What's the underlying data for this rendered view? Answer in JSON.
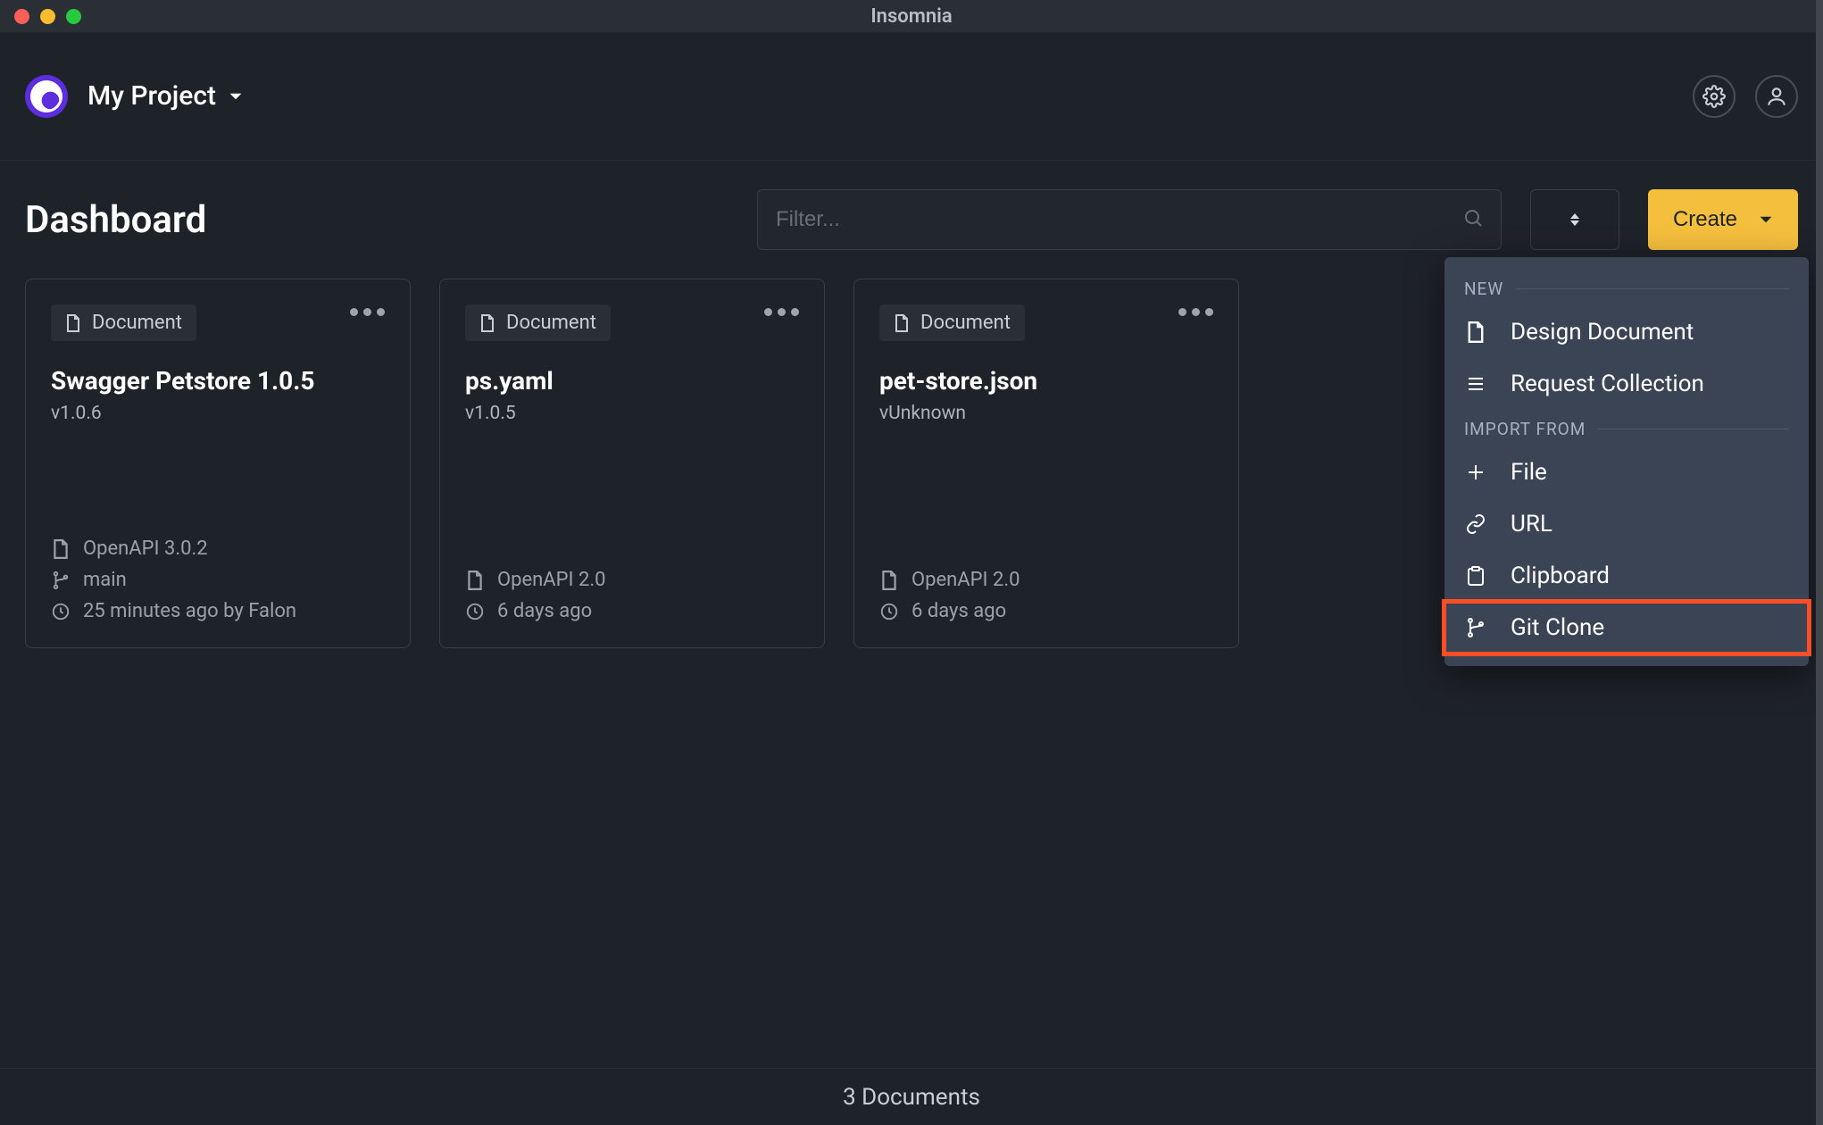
{
  "app": {
    "title": "Insomnia"
  },
  "header": {
    "project_name": "My Project"
  },
  "toolbar": {
    "page_title": "Dashboard",
    "filter_placeholder": "Filter...",
    "create_label": "Create"
  },
  "cards": [
    {
      "tag": "Document",
      "title": "Swagger Petstore 1.0.5",
      "version": "v1.0.6",
      "spec": "OpenAPI 3.0.2",
      "branch": "main",
      "time": "25 minutes ago by Falon"
    },
    {
      "tag": "Document",
      "title": "ps.yaml",
      "version": "v1.0.5",
      "spec": "OpenAPI 2.0",
      "branch": "",
      "time": "6 days ago"
    },
    {
      "tag": "Document",
      "title": "pet-store.json",
      "version": "vUnknown",
      "spec": "OpenAPI 2.0",
      "branch": "",
      "time": "6 days ago"
    }
  ],
  "dropdown": {
    "section_new": "NEW",
    "section_import": "IMPORT FROM",
    "items_new": [
      {
        "label": "Design Document"
      },
      {
        "label": "Request Collection"
      }
    ],
    "items_import": [
      {
        "label": "File"
      },
      {
        "label": "URL"
      },
      {
        "label": "Clipboard"
      },
      {
        "label": "Git Clone"
      }
    ]
  },
  "status": {
    "text": "3 Documents"
  }
}
